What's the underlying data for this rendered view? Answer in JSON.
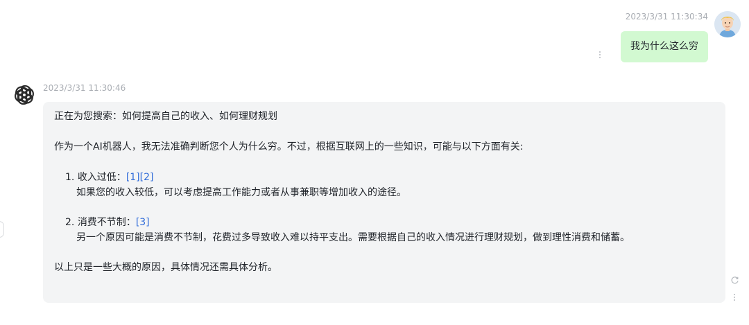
{
  "user_message": {
    "timestamp": "2023/3/31 11:30:34",
    "text": "我为什么这么穷",
    "avatar_icon": "cartoon-avatar-icon",
    "bubble_color": "#d2f9d1"
  },
  "bot_message": {
    "timestamp": "2023/3/31 11:30:46",
    "logo_icon": "openai-logo-icon",
    "searching": "正在为您搜索：如何提高自己的收入、如何理财规划",
    "intro": "作为一个AI机器人，我无法准确判断您个人为什么穷。不过，根据互联网上的一些知识，可能与以下方面有关:",
    "items": [
      {
        "number": "1.",
        "title": "收入过低：",
        "refs": [
          "[1]",
          "[2]"
        ],
        "body": "如果您的收入较低，可以考虑提高工作能力或者从事兼职等增加收入的途径。"
      },
      {
        "number": "2.",
        "title": "消费不节制：",
        "refs": [
          "[3]"
        ],
        "body": "另一个原因可能是消费不节制，花费过多导致收入难以持平支出。需要根据自己的收入情况进行理财规划，做到理性消费和储蓄。"
      }
    ],
    "conclusion": "以上只是一些大概的原因，具体情况还需具体分析。",
    "bubble_color": "#f3f4f5",
    "link_color": "#2f6bd9"
  },
  "icons": {
    "menu": "more-vertical-icon",
    "refresh": "refresh-icon",
    "collapse": "collapse-handle-icon"
  }
}
